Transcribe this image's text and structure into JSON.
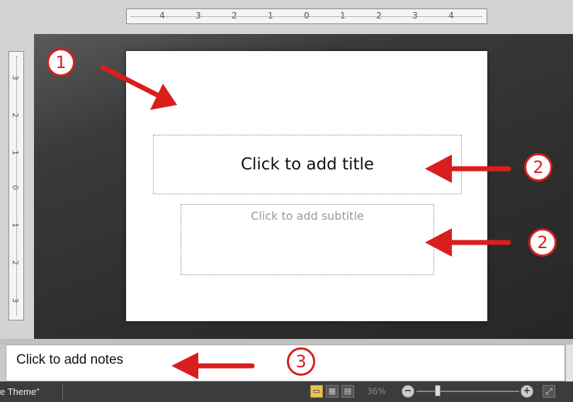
{
  "ruler": {
    "horizontal_labels": [
      "4",
      "3",
      "2",
      "1",
      "0",
      "1",
      "2",
      "3",
      "4"
    ],
    "vertical_labels": [
      "3",
      "2",
      "1",
      "0",
      "1",
      "2",
      "3"
    ]
  },
  "slide": {
    "title_placeholder": "Click to add title",
    "subtitle_placeholder": "Click to add subtitle"
  },
  "notes": {
    "placeholder": "Click to add notes"
  },
  "status_bar": {
    "theme_label": "e Theme\"",
    "zoom_level": "36%"
  },
  "callouts": [
    "1",
    "2",
    "2",
    "3"
  ],
  "colors": {
    "annotation_red": "#d91e1e",
    "normal_view_active": "#e8c25a"
  },
  "icons": {
    "normal_view": "normal-view-icon",
    "slide_sorter": "slide-sorter-icon",
    "slide_show": "slide-show-icon",
    "zoom_out": "zoom-out-icon",
    "zoom_in": "zoom-in-icon",
    "fit_window": "fit-to-window-icon"
  }
}
